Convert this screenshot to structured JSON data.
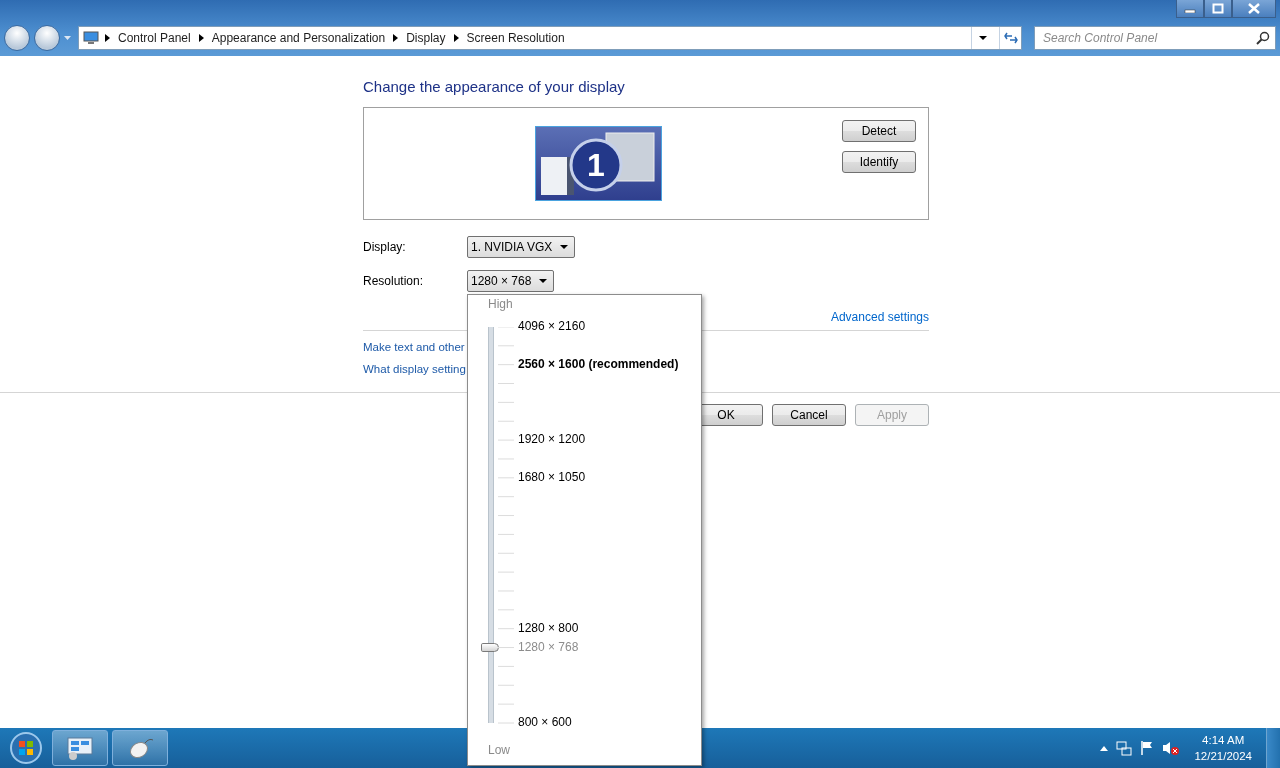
{
  "window": {
    "breadcrumb": [
      "Control Panel",
      "Appearance and Personalization",
      "Display",
      "Screen Resolution"
    ],
    "search": {
      "placeholder": "Search Control Panel"
    }
  },
  "heading": "Change the appearance of your display",
  "preview": {
    "monitor_number": "1",
    "buttons": [
      "Detect",
      "Identify"
    ]
  },
  "display": {
    "label": "Display:",
    "value": "1. NVIDIA VGX"
  },
  "resolution": {
    "label": "Resolution:",
    "value": "1280 × 768"
  },
  "advanced_link": "Advanced settings",
  "links": [
    "Make text and other",
    "What display setting"
  ],
  "buttons": [
    {
      "label": "OK",
      "disabled": false
    },
    {
      "label": "Cancel",
      "disabled": false
    },
    {
      "label": "Apply",
      "disabled": true
    }
  ],
  "resolution_popup": {
    "high_label": "High",
    "low_label": "Low",
    "level": 0.19,
    "options": [
      {
        "label": "4096 × 2160",
        "recommended": false,
        "selected": false
      },
      {
        "label": "2560 × 1600 (recommended)",
        "recommended": true,
        "selected": false
      },
      {
        "label": "1920 × 1200",
        "recommended": false,
        "selected": false
      },
      {
        "label": "1680 × 1050",
        "recommended": false,
        "selected": false
      },
      {
        "label": "1280 × 800",
        "recommended": false,
        "selected": false
      },
      {
        "label": "1280 × 768",
        "recommended": false,
        "selected": true
      },
      {
        "label": "800 × 600",
        "recommended": false,
        "selected": false
      }
    ]
  },
  "taskbar": {
    "time": "4:14 AM",
    "date": "12/21/2024"
  }
}
